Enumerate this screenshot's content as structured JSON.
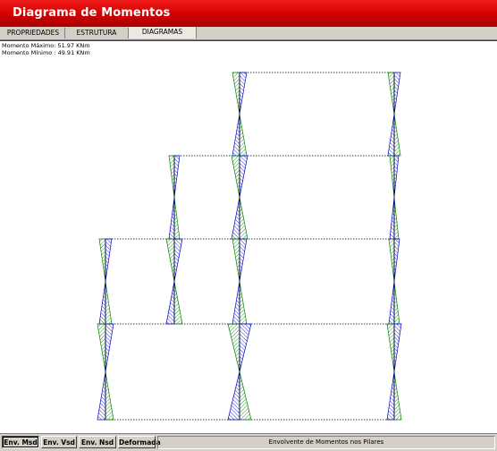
{
  "window": {
    "title": "Diagrama de Momentos",
    "accent_color": "#d00000"
  },
  "tabs": [
    {
      "label": "PROPRIEDADES",
      "active": false
    },
    {
      "label": "ESTRUTURA",
      "active": false
    },
    {
      "label": "DIAGRAMAS",
      "active": true
    }
  ],
  "canvas_info": {
    "moment_max": "Momento Máximo: 51.97 KNm",
    "moment_min": "Momento Mínimo : 49.91 KNm"
  },
  "diagram": {
    "positive_color": "#008000",
    "negative_color": "#0000cc",
    "frame_line_color": "#000000"
  },
  "toolbar": {
    "buttons": [
      {
        "label": "Env. Msd",
        "pressed": true
      },
      {
        "label": "Env. Vsd",
        "pressed": false
      },
      {
        "label": "Env. Nsd",
        "pressed": false
      },
      {
        "label": "Deformada",
        "pressed": false
      }
    ],
    "status": "Envolvente de Momentos nos Pilares"
  }
}
